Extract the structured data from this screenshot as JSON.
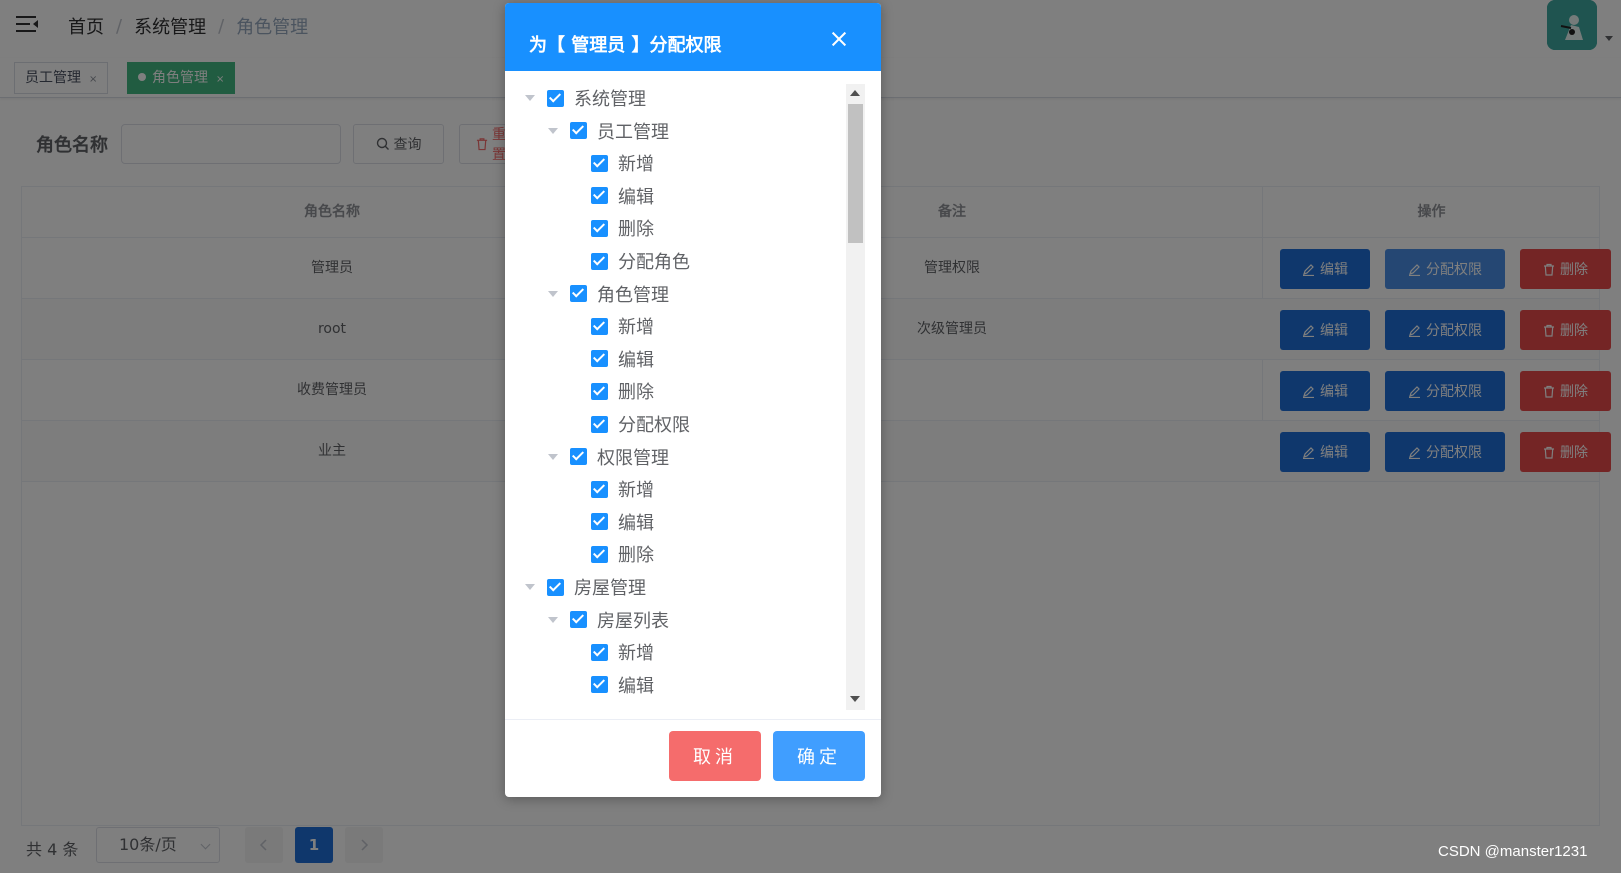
{
  "breadcrumb": [
    "首页",
    "系统管理",
    "角色管理"
  ],
  "tags": [
    {
      "label": "员工管理",
      "active": false
    },
    {
      "label": "角色管理",
      "active": true
    }
  ],
  "search": {
    "label": "角色名称",
    "value": "",
    "query_label": "查询",
    "reset_label": "重置"
  },
  "table": {
    "columns": [
      "角色名称",
      "备注",
      "操作"
    ],
    "rows": [
      {
        "name": "管理员",
        "note": "管理权限"
      },
      {
        "name": "root",
        "note": "次级管理员"
      },
      {
        "name": "收费管理员",
        "note": ""
      },
      {
        "name": "业主",
        "note": ""
      }
    ],
    "actions": {
      "edit": "编辑",
      "perm": "分配权限",
      "del": "删除"
    }
  },
  "pagination": {
    "total": "共 4 条",
    "page_size": "10条/页",
    "current": "1"
  },
  "dialog": {
    "title": "为【 管理员 】分配权限",
    "tree": [
      {
        "label": "系统管理",
        "level": 0,
        "expand": true
      },
      {
        "label": "员工管理",
        "level": 1,
        "expand": true
      },
      {
        "label": "新增",
        "level": 2
      },
      {
        "label": "编辑",
        "level": 2
      },
      {
        "label": "删除",
        "level": 2
      },
      {
        "label": "分配角色",
        "level": 2
      },
      {
        "label": "角色管理",
        "level": 1,
        "expand": true
      },
      {
        "label": "新增",
        "level": 2
      },
      {
        "label": "编辑",
        "level": 2
      },
      {
        "label": "删除",
        "level": 2
      },
      {
        "label": "分配权限",
        "level": 2
      },
      {
        "label": "权限管理",
        "level": 1,
        "expand": true
      },
      {
        "label": "新增",
        "level": 2
      },
      {
        "label": "编辑",
        "level": 2
      },
      {
        "label": "删除",
        "level": 2
      },
      {
        "label": "房屋管理",
        "level": 0,
        "expand": true
      },
      {
        "label": "房屋列表",
        "level": 1,
        "expand": true
      },
      {
        "label": "新增",
        "level": 2
      },
      {
        "label": "编辑",
        "level": 2
      }
    ],
    "cancel_label": "取消",
    "ok_label": "确定"
  },
  "watermark": "CSDN @manster1231",
  "colors": {
    "primary": "#1890ff",
    "tag_active": "#42b983",
    "danger": "#f56c6c"
  }
}
